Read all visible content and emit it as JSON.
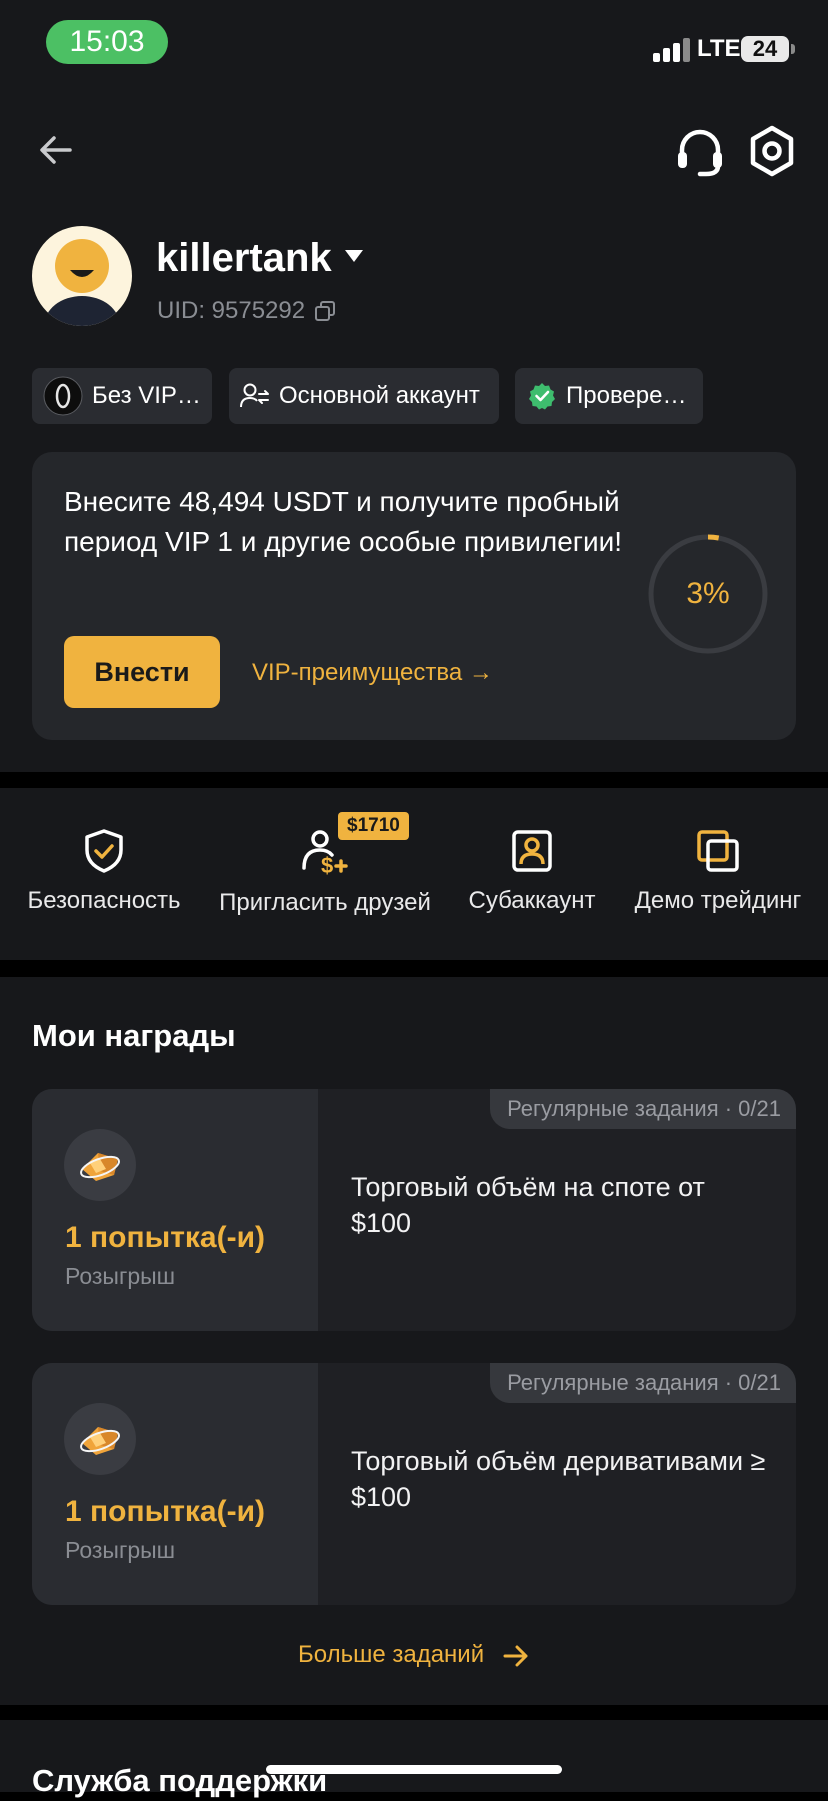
{
  "status_bar": {
    "time": "15:03",
    "network": "LTE",
    "battery": "24"
  },
  "profile": {
    "username": "killertank",
    "uid": "UID: 9575292"
  },
  "chips": {
    "vip": "Без VIP…",
    "account": "Основной аккаунт",
    "verified": "Провере…"
  },
  "vip_card": {
    "text": "Внесите 48,494 USDT и получите пробный период VIP 1 и другие особые привилегии!",
    "deposit_button": "Внести",
    "benefits_link": "VIP-преимущества →",
    "progress_label": "3%",
    "progress": 0.03
  },
  "quick_actions": {
    "security": "Безопасность",
    "invite": "Пригласить друзей",
    "invite_badge": "$1710",
    "subaccount": "Субаккаунт",
    "demo": "Демо трейдинг"
  },
  "rewards": {
    "title": "Мои награды",
    "items": [
      {
        "count": "1 попытка(-и)",
        "type": "Розыгрыш",
        "tag": "Регулярные задания · 0/21",
        "description": "Торговый объём на споте от $100"
      },
      {
        "count": "1 попытка(-и)",
        "type": "Розыгрыш",
        "tag": "Регулярные задания · 0/21",
        "description": "Торговый объём деривативами ≥ $100"
      }
    ],
    "more_tasks": "Больше заданий"
  },
  "support": {
    "title": "Служба поддержки"
  },
  "colors": {
    "accent": "#f0b33f",
    "background": "#17181b",
    "card": "#25272b",
    "verified": "#3ebd6e",
    "status_time_pill": "#4cc064"
  }
}
